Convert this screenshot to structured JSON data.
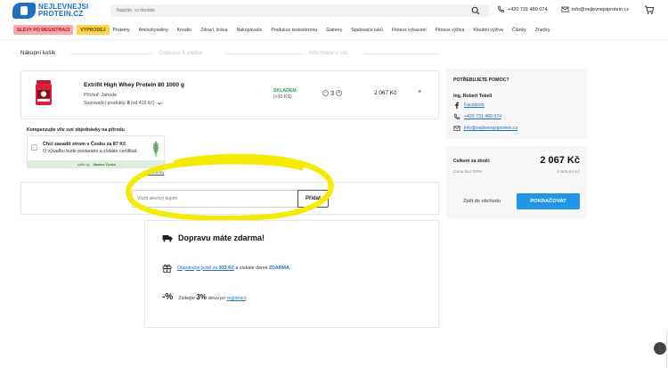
{
  "header": {
    "logo": {
      "line1": "NEJLEVNEJSI",
      "line2": "PROTEIN.CZ"
    },
    "search_placeholder": "Napište, co hledáte",
    "phone": "+420 731 489 074",
    "email": "info@nejlevnejsiprotein.cz"
  },
  "nav": {
    "promo_red": "SLEVY PO REGISTRACI",
    "promo_yellow": "VÝPRODEJ",
    "items": [
      "Proteiny",
      "Aminokyseliny",
      "Kreatin",
      "Zdraví, krása",
      "Nakopávače",
      "Produkce testosteronu",
      "Gainery",
      "Spalovače tuků",
      "Fitness vybavení",
      "Fitness výživa",
      "Kloubní výživa",
      "Články",
      "Značky"
    ]
  },
  "steps": [
    "Nákupní košík",
    "Doprava & platba",
    "Informace o vás"
  ],
  "cart_item": {
    "name": "Extrifit High Whey Protein 80 1000 g",
    "flavor": "Příchuť: Jahoda",
    "related_label": "Související produkty:",
    "related_count": "8",
    "related_price": "(od 419 Kč)",
    "stock_status": "SKLADEM",
    "stock_qty": "(>10 KS)",
    "quantity": "3",
    "price": "2 067 Kč",
    "remove_symbol": "×"
  },
  "eco": {
    "title": "Kompenzujte vliv své objednávky na přírodu",
    "line1": "Chci zasadit strom v Česku za 87 Kč",
    "line2": "O výsadbu bude postaráno a získáte certifikát.",
    "footer_label": "vyšlo by",
    "footer_brand": "Sázíme Česko",
    "link": "Podmínky"
  },
  "coupon": {
    "placeholder": "Vložit slevový kupón",
    "button": "Přidat"
  },
  "info": {
    "shipping": "Dopravu máte zdarma!",
    "gift_pre": "Objednejte ještě za",
    "gift_amount": "933 Kč",
    "gift_mid": "a získáte dárek",
    "gift_free": "ZDARMA",
    "pct_symbol": "-%",
    "pct_pre": "Získejte",
    "pct_value": "3%",
    "pct_mid": "slevu po",
    "pct_link": "registraci"
  },
  "help": {
    "title": "POTŘEBUJETE POMOC?",
    "name": "Ing. Robert Tekeli",
    "facebook": "Facebook",
    "phone": "+420 731 489 074",
    "email": "info@nejlevnejsiprotein.cz"
  },
  "summary": {
    "total_label": "Celkem za zboží:",
    "total_value": "2 067 Kč",
    "novat_label": "Cena bez DPH",
    "novat_value": "1 845,54 Kč",
    "back": "Zpět do obchodu",
    "continue": "POKRAČOVAT"
  },
  "colors": {
    "brand_blue": "#1f6fc2",
    "cta_blue": "#2196e6",
    "stock_green": "#22a34a",
    "annotation_yellow": "#f5ea00"
  }
}
